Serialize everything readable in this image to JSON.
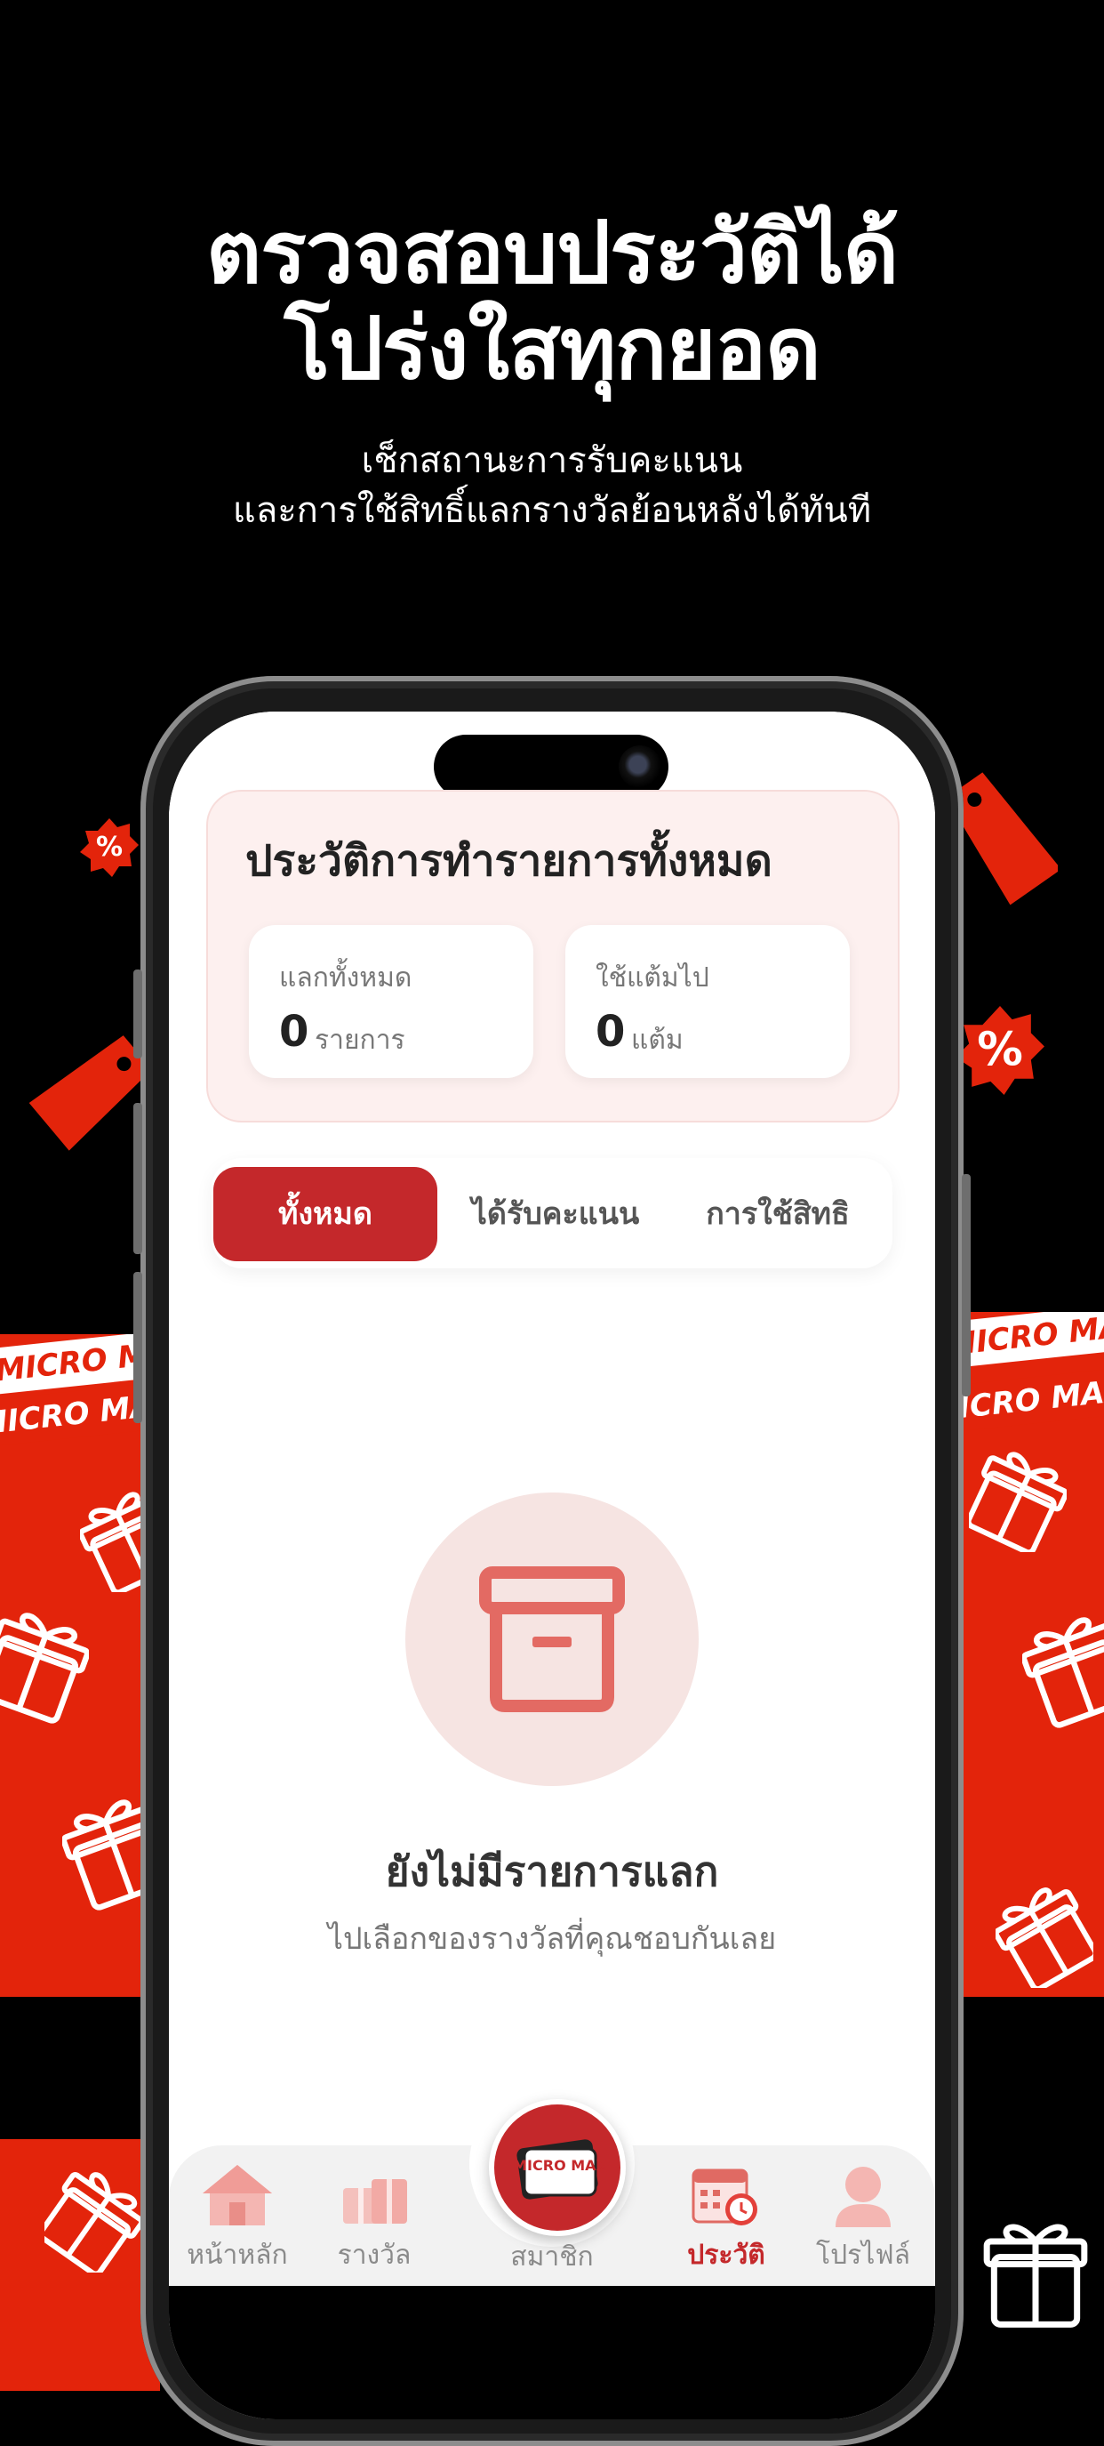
{
  "promo": {
    "headline_line1": "ตรวจสอบประวัติได้",
    "headline_line2": "โปร่งใสทุกยอด",
    "sub_line1": "เช็กสถานะการรับคะแนน",
    "sub_line2": "และการใช้สิทธิ์แลกรางวัลย้อนหลังได้ทันที"
  },
  "decor": {
    "stripe_text": "MICRO MAX . MICRO MAX . MICRO",
    "badge_symbol": "%"
  },
  "summary": {
    "title": "ประวัติการทำรายการทั้งหมด",
    "redeemed_label": "แลกทั้งหมด",
    "redeemed_value": "0",
    "redeemed_unit": "รายการ",
    "points_label": "ใช้แต้มไป",
    "points_value": "0",
    "points_unit": "แต้ม"
  },
  "tabs": [
    {
      "label": "ทั้งหมด",
      "active": true
    },
    {
      "label": "ได้รับคะแนน",
      "active": false
    },
    {
      "label": "การใช้สิทธิ",
      "active": false
    }
  ],
  "empty_state": {
    "icon": "archive-box-icon",
    "title": "ยังไม่มีรายการแลก",
    "subtitle": "ไปเลือกของรางวัลที่คุณชอบกันเลย"
  },
  "nav": {
    "home": "หน้าหลัก",
    "rewards": "รางวัล",
    "member": "สมาชิก",
    "history": "ประวัติ",
    "profile": "โปรไฟล์",
    "active": "history",
    "member_card_text": "MICRO MAX"
  },
  "colors": {
    "brand_red": "#c4282b",
    "background_red": "#e3240b",
    "accent_pink": "#f6e4e2"
  }
}
